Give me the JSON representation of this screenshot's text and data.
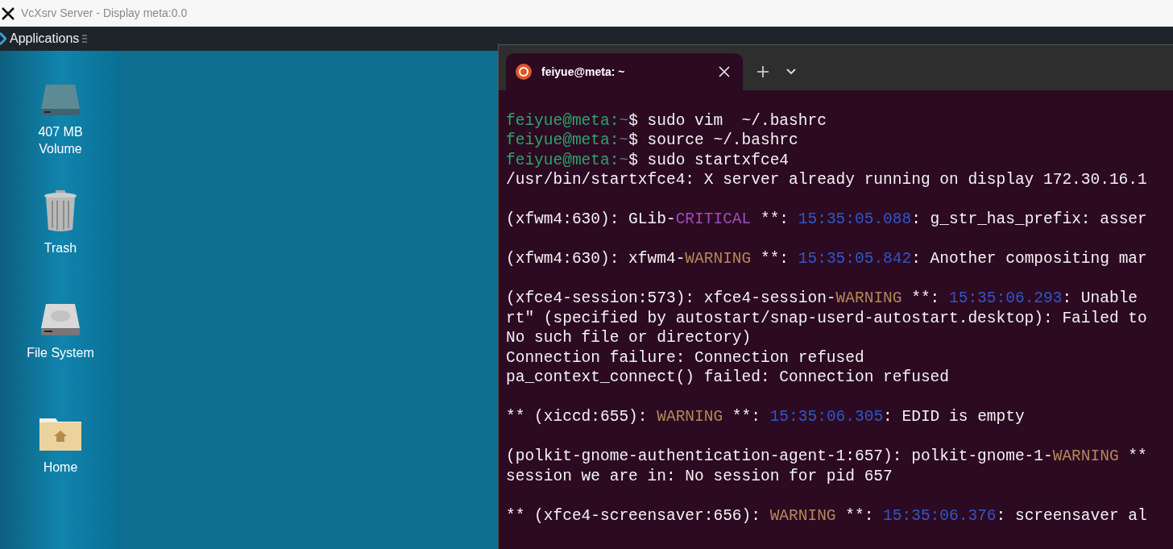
{
  "window": {
    "title": "VcXsrv Server - Display meta:0.0"
  },
  "panel": {
    "menu_label": "Applications"
  },
  "desktop_icons": [
    {
      "kind": "volume",
      "label": "407 MB\nVolume"
    },
    {
      "kind": "trash",
      "label": "Trash"
    },
    {
      "kind": "filesystem",
      "label": "File System"
    },
    {
      "kind": "home",
      "label": "Home"
    }
  ],
  "terminal": {
    "tabs": [
      {
        "title": "feiyue@meta: ~",
        "selected": true
      }
    ],
    "lines": [
      {
        "kind": "blank"
      },
      {
        "kind": "text",
        "segments": [
          {
            "kind": "user",
            "text": "feiyue@meta:"
          },
          {
            "kind": "path",
            "text": "~"
          },
          {
            "kind": "plain",
            "text": "$ sudo vim  ~/.bashrc"
          }
        ]
      },
      {
        "kind": "text",
        "segments": [
          {
            "kind": "user",
            "text": "feiyue@meta:"
          },
          {
            "kind": "path",
            "text": "~"
          },
          {
            "kind": "plain",
            "text": "$ source ~/.bashrc"
          }
        ]
      },
      {
        "kind": "text",
        "segments": [
          {
            "kind": "user",
            "text": "feiyue@meta:"
          },
          {
            "kind": "path",
            "text": "~"
          },
          {
            "kind": "plain",
            "text": "$ sudo startxfce4"
          }
        ]
      },
      {
        "kind": "text",
        "segments": [
          {
            "kind": "plain",
            "text": "/usr/bin/startxfce4: X server already running on display 172.30.16.1"
          }
        ]
      },
      {
        "kind": "blank"
      },
      {
        "kind": "text",
        "segments": [
          {
            "kind": "plain",
            "text": "(xfwm4:630): GLib-"
          },
          {
            "kind": "critical",
            "text": "CRITICAL"
          },
          {
            "kind": "plain",
            "text": " **: "
          },
          {
            "kind": "time",
            "text": "15:35:05.088"
          },
          {
            "kind": "plain",
            "text": ": g_str_has_prefix: asser"
          }
        ]
      },
      {
        "kind": "blank"
      },
      {
        "kind": "text",
        "segments": [
          {
            "kind": "plain",
            "text": "(xfwm4:630): xfwm4-"
          },
          {
            "kind": "warning",
            "text": "WARNING"
          },
          {
            "kind": "plain",
            "text": " **: "
          },
          {
            "kind": "time",
            "text": "15:35:05.842"
          },
          {
            "kind": "plain",
            "text": ": Another compositing mar"
          }
        ]
      },
      {
        "kind": "blank"
      },
      {
        "kind": "text",
        "segments": [
          {
            "kind": "plain",
            "text": "(xfce4-session:573): xfce4-session-"
          },
          {
            "kind": "warning",
            "text": "WARNING"
          },
          {
            "kind": "plain",
            "text": " **: "
          },
          {
            "kind": "time",
            "text": "15:35:06.293"
          },
          {
            "kind": "plain",
            "text": ": Unable"
          }
        ]
      },
      {
        "kind": "text",
        "segments": [
          {
            "kind": "plain",
            "text": "rt\" (specified by autostart/snap-userd-autostart.desktop): Failed to"
          }
        ]
      },
      {
        "kind": "text",
        "segments": [
          {
            "kind": "plain",
            "text": "No such file or directory)"
          }
        ]
      },
      {
        "kind": "text",
        "segments": [
          {
            "kind": "plain",
            "text": "Connection failure: Connection refused"
          }
        ]
      },
      {
        "kind": "text",
        "segments": [
          {
            "kind": "plain",
            "text": "pa_context_connect() failed: Connection refused"
          }
        ]
      },
      {
        "kind": "blank"
      },
      {
        "kind": "text",
        "segments": [
          {
            "kind": "plain",
            "text": "** (xiccd:655): "
          },
          {
            "kind": "warning",
            "text": "WARNING"
          },
          {
            "kind": "plain",
            "text": " **: "
          },
          {
            "kind": "time",
            "text": "15:35:06.305"
          },
          {
            "kind": "plain",
            "text": ": EDID is empty"
          }
        ]
      },
      {
        "kind": "blank"
      },
      {
        "kind": "text",
        "segments": [
          {
            "kind": "plain",
            "text": "(polkit-gnome-authentication-agent-1:657): polkit-gnome-1-"
          },
          {
            "kind": "warning",
            "text": "WARNING"
          },
          {
            "kind": "plain",
            "text": " **"
          }
        ]
      },
      {
        "kind": "text",
        "segments": [
          {
            "kind": "plain",
            "text": "session we are in: No session for pid 657"
          }
        ]
      },
      {
        "kind": "blank"
      },
      {
        "kind": "text",
        "segments": [
          {
            "kind": "plain",
            "text": "** (xfce4-screensaver:656): "
          },
          {
            "kind": "warning",
            "text": "WARNING"
          },
          {
            "kind": "plain",
            "text": " **: "
          },
          {
            "kind": "time",
            "text": "15:35:06.376"
          },
          {
            "kind": "plain",
            "text": ": screensaver al"
          }
        ]
      }
    ]
  }
}
